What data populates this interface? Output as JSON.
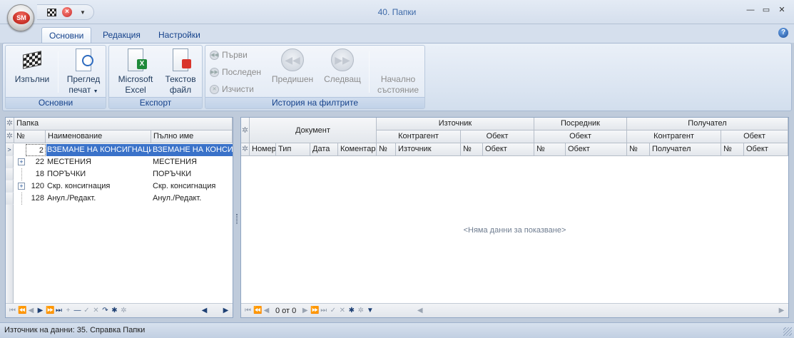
{
  "window": {
    "title": "40. Папки",
    "orb_label": "SM"
  },
  "tabs": [
    {
      "label": "Основни"
    },
    {
      "label": "Редакция"
    },
    {
      "label": "Настройки"
    }
  ],
  "ribbon": {
    "groups": {
      "main": {
        "label": "Основни",
        "execute": "Изпълни",
        "preview_line1": "Преглед",
        "preview_line2": "печат"
      },
      "export": {
        "label": "Експорт",
        "excel_line1": "Microsoft",
        "excel_line2": "Excel",
        "text_line1": "Текстов",
        "text_line2": "файл"
      },
      "history": {
        "label": "История на филтрите",
        "first": "Първи",
        "last": "Последен",
        "clear": "Изчисти",
        "previous": "Предишен",
        "next": "Следващ",
        "initial_line1": "Начално",
        "initial_line2": "състояние"
      }
    }
  },
  "left_grid": {
    "group_header": "Папка",
    "columns": {
      "no": "№",
      "name": "Наименование",
      "fullname": "Пълно име"
    },
    "rows": [
      {
        "no": "2",
        "name": "ВЗЕМАНЕ НА КОНСИГНАЦИЯ",
        "fullname": "ВЗЕМАНЕ НА КОНСИГН"
      },
      {
        "no": "22",
        "name": "МЕСТЕНИЯ",
        "fullname": "МЕСТЕНИЯ"
      },
      {
        "no": "18",
        "name": "ПОРЪЧКИ",
        "fullname": "ПОРЪЧКИ"
      },
      {
        "no": "120",
        "name": "Скр. консигнация",
        "fullname": "Скр. консигнация"
      },
      {
        "no": "128",
        "name": "Анул./Редакт.",
        "fullname": "Анул./Редакт."
      }
    ]
  },
  "right_grid": {
    "bands": {
      "document": "Документ",
      "source": "Източник",
      "intermediary": "Посредник",
      "recipient": "Получател",
      "contractor": "Контрагент",
      "object": "Обект"
    },
    "columns": {
      "number": "Номер",
      "type": "Тип",
      "date": "Дата",
      "comment": "Коментар",
      "no": "№",
      "source": "Източник",
      "object": "Обект",
      "recipient": "Получател"
    },
    "empty_text": "<Няма данни за показване>",
    "record_counter": "0 от 0"
  },
  "statusbar": {
    "text": "Източник на данни: 35. Справка Папки"
  }
}
